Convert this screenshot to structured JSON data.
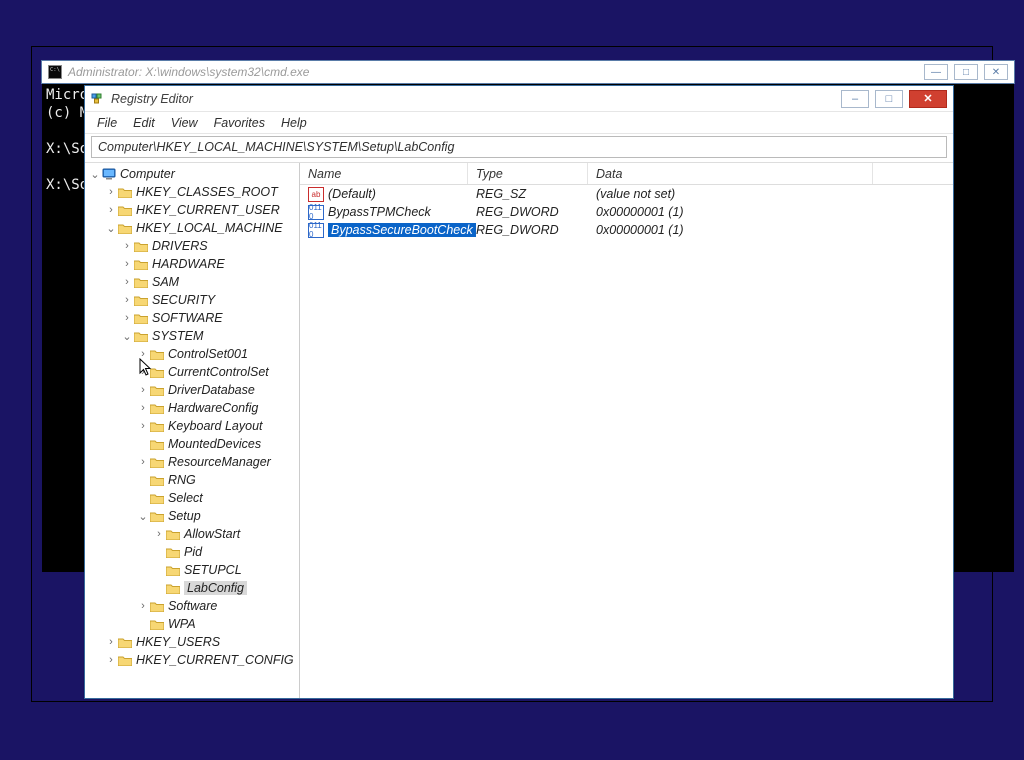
{
  "cmd": {
    "title": "Administrator: X:\\windows\\system32\\cmd.exe",
    "line1": "Micro",
    "line2": "(c) M",
    "line3": "",
    "line4": "X:\\So",
    "line5": "",
    "line6": "X:\\So"
  },
  "reg": {
    "title": "Registry Editor",
    "menu": {
      "file": "File",
      "edit": "Edit",
      "view": "View",
      "favorites": "Favorites",
      "help": "Help"
    },
    "address": "Computer\\HKEY_LOCAL_MACHINE\\SYSTEM\\Setup\\LabConfig",
    "tree": {
      "root": "Computer",
      "hkcr": "HKEY_CLASSES_ROOT",
      "hkcu": "HKEY_CURRENT_USER",
      "hklm": "HKEY_LOCAL_MACHINE",
      "hklm_drivers": "DRIVERS",
      "hklm_hardware": "HARDWARE",
      "hklm_sam": "SAM",
      "hklm_security": "SECURITY",
      "hklm_software": "SOFTWARE",
      "hklm_system": "SYSTEM",
      "sys_cs001": "ControlSet001",
      "sys_ccs": "CurrentControlSet",
      "sys_driverdb": "DriverDatabase",
      "sys_hwcfg": "HardwareConfig",
      "sys_kbd": "Keyboard Layout",
      "sys_mounted": "MountedDevices",
      "sys_resmgr": "ResourceManager",
      "sys_rng": "RNG",
      "sys_select": "Select",
      "sys_setup": "Setup",
      "setup_allow": "AllowStart",
      "setup_pid": "Pid",
      "setup_setupcl": "SETUPCL",
      "setup_lab": "LabConfig",
      "sys_software": "Software",
      "sys_wpa": "WPA",
      "hku": "HKEY_USERS",
      "hkcc": "HKEY_CURRENT_CONFIG"
    },
    "list": {
      "headers": {
        "name": "Name",
        "type": "Type",
        "data": "Data"
      },
      "rows": [
        {
          "icon": "str",
          "name": "(Default)",
          "type": "REG_SZ",
          "data": "(value not set)",
          "selected": false
        },
        {
          "icon": "dw",
          "name": "BypassTPMCheck",
          "type": "REG_DWORD",
          "data": "0x00000001 (1)",
          "selected": false
        },
        {
          "icon": "dw",
          "name": "BypassSecureBootCheck",
          "type": "REG_DWORD",
          "data": "0x00000001 (1)",
          "selected": true
        }
      ]
    }
  },
  "buttons": {
    "min": "—",
    "max": "□",
    "close": "✕",
    "minus": "–",
    "x": "✕"
  }
}
